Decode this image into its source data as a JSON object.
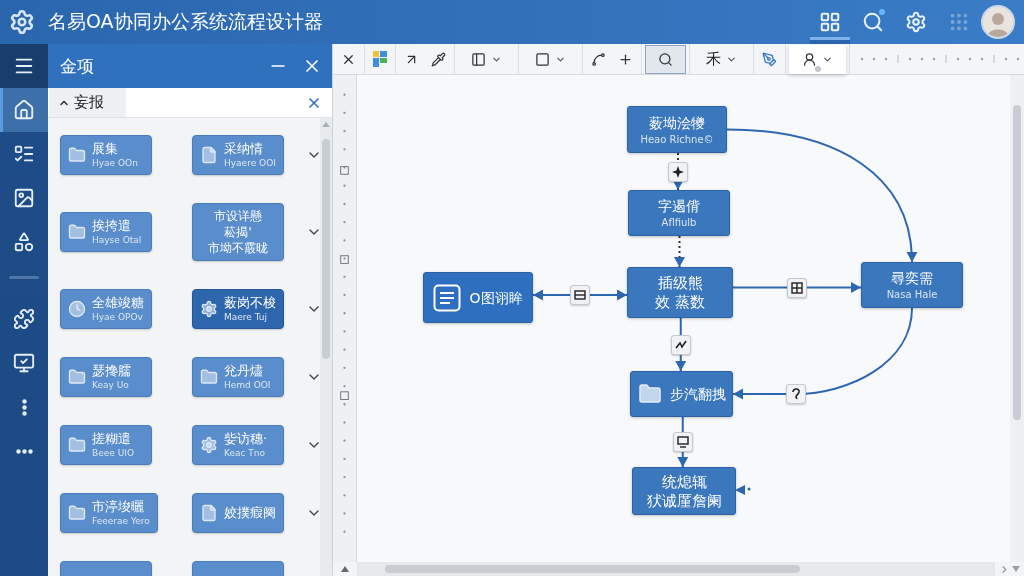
{
  "window": {
    "title": "名易OA协同办公系统流程设计器"
  },
  "header_tools": [
    {
      "selected": true,
      "dot": false,
      "disabled": false
    },
    {
      "selected": false,
      "dot": true,
      "disabled": false
    },
    {
      "selected": false,
      "dot": false,
      "disabled": false
    },
    {
      "selected": false,
      "dot": false,
      "disabled": true
    }
  ],
  "nav_rail": {
    "groups": [
      [
        {
          "selected": false
        },
        {
          "selected": true
        },
        {
          "selected": false
        },
        {
          "selected": false
        },
        {
          "selected": false
        }
      ],
      [
        {
          "selected": false
        },
        {
          "selected": false
        },
        {
          "selected": false
        },
        {
          "selected": false
        }
      ]
    ]
  },
  "panel": {
    "title": "金项",
    "filter": {
      "value": "妄报"
    },
    "rows": [
      {
        "expanded": false,
        "items": [
          {
            "kind": "folder",
            "selected": false,
            "title": "展集",
            "subtitle": "Hyae OOn"
          },
          {
            "kind": "document",
            "selected": false,
            "title": "采纳情",
            "subtitle": "Hyaere OOI"
          }
        ]
      },
      {
        "expanded": false,
        "items": [
          {
            "kind": "folder",
            "selected": false,
            "title": "挨挎遣",
            "subtitle": "Hayse Otal"
          },
          {
            "kind": "text",
            "selected": false,
            "lines": [
              "市设详懸",
              "菘揭'",
              "市坳不霰昽"
            ]
          }
        ]
      },
      {
        "expanded": false,
        "items": [
          {
            "kind": "clock",
            "selected": false,
            "title": "全雄竣糖",
            "subtitle": "Hyae OPOv"
          },
          {
            "kind": "gear",
            "selected": true,
            "title": "薮岗不梭",
            "subtitle": "Maere Tuj"
          }
        ]
      },
      {
        "expanded": false,
        "items": [
          {
            "kind": "folder",
            "selected": false,
            "title": "瑟搀臑",
            "subtitle": "Keay Uo"
          },
          {
            "kind": "folder",
            "selected": false,
            "title": "兊丹燼",
            "subtitle": "Hemd OOI"
          }
        ]
      },
      {
        "expanded": false,
        "items": [
          {
            "kind": "folder",
            "selected": false,
            "title": "搓糊遣",
            "subtitle": "Beee UIO"
          },
          {
            "kind": "gear",
            "selected": false,
            "title": "姕访穗·",
            "subtitle": "Keac Tno"
          }
        ]
      },
      {
        "expanded": false,
        "items": [
          {
            "kind": "folder",
            "selected": false,
            "title": "市渟埈曬",
            "subtitle": "Feeerae Yero"
          },
          {
            "kind": "document",
            "selected": false,
            "title": "姣撲瘕阕"
          }
        ]
      },
      {
        "items": [
          {
            "kind": "blank",
            "selected": false
          },
          {
            "kind": "blank",
            "selected": false
          }
        ]
      }
    ]
  },
  "toolbar": {
    "groups": [
      [
        {
          "selected": false,
          "dropdown": false,
          "open": false
        }
      ],
      [
        {
          "selected": false,
          "dropdown": false,
          "open": false
        }
      ],
      [
        {
          "selected": false,
          "dropdown": false,
          "open": false
        },
        {
          "selected": false,
          "dropdown": false,
          "open": false
        }
      ],
      [
        {
          "selected": false,
          "dropdown": true,
          "open": false
        }
      ],
      [
        {
          "selected": false,
          "dropdown": true,
          "open": false
        }
      ],
      [
        {
          "selected": false,
          "dropdown": false,
          "open": false
        },
        {
          "selected": false,
          "dropdown": false,
          "open": false
        }
      ],
      [
        {
          "selected": true,
          "dropdown": false,
          "open": false
        }
      ],
      [
        {
          "label": "禾",
          "selected": false,
          "dropdown": true,
          "open": false
        }
      ],
      [
        {
          "selected": false,
          "dropdown": false,
          "open": false
        }
      ],
      [
        {
          "selected": false,
          "dropdown": true,
          "open": true
        }
      ]
    ]
  },
  "canvas": {
    "nodes": [
      {
        "kind": "step",
        "title": "薮坳浍犪",
        "subtitle": "Heao Richne©"
      },
      {
        "kind": "step",
        "title": "字遏偝",
        "subtitle": "Aflfiulb"
      },
      {
        "kind": "form",
        "title": "O图诩眸"
      },
      {
        "kind": "text",
        "lines": [
          "插级熊",
          "效 蒸数"
        ]
      },
      {
        "kind": "step",
        "title": "尋奕需",
        "subtitle": "Nasa Hale"
      },
      {
        "kind": "folder",
        "title": "步汽翻拽"
      },
      {
        "kind": "text",
        "lines": [
          "统熄辄",
          "犾诚厪詹阑"
        ]
      }
    ],
    "edges": [
      {
        "both_ends": false,
        "tile": true
      },
      {
        "both_ends": false,
        "tile": false
      },
      {
        "both_ends": true,
        "tile": true
      },
      {
        "both_ends": false,
        "tile": true
      },
      {
        "both_ends": false,
        "tile": false
      },
      {
        "both_ends": false,
        "tile": true
      },
      {
        "both_ends": false,
        "tile": true
      },
      {
        "both_ends": false,
        "tile": true
      }
    ]
  }
}
